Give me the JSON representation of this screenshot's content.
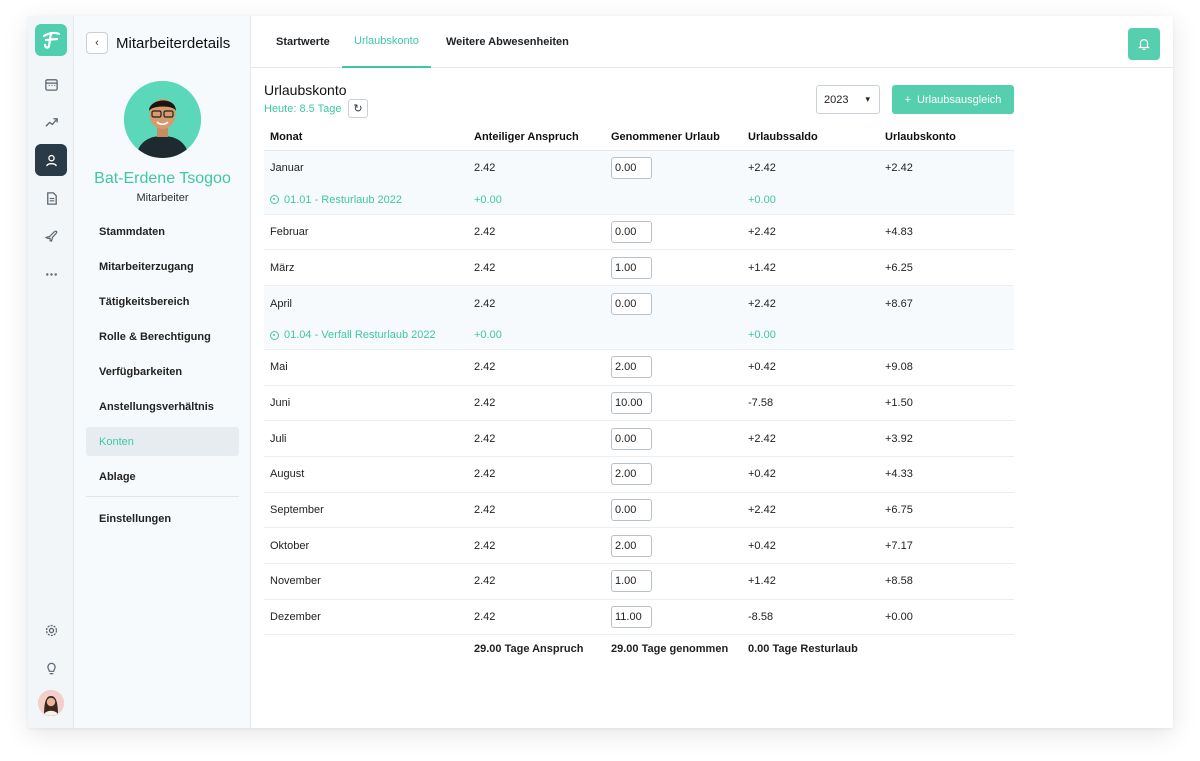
{
  "panel": {
    "title": "Mitarbeiterdetails",
    "name": "Bat-Erdene Tsogoo",
    "role": "Mitarbeiter",
    "nav": [
      {
        "label": "Stammdaten",
        "active": false
      },
      {
        "label": "Mitarbeiterzugang",
        "active": false
      },
      {
        "label": "Tätigkeitsbereich",
        "active": false
      },
      {
        "label": "Rolle & Berechtigung",
        "active": false
      },
      {
        "label": "Verfügbarkeiten",
        "active": false
      },
      {
        "label": "Anstellungsverhältnis",
        "active": false
      },
      {
        "label": "Konten",
        "active": true
      },
      {
        "label": "Ablage",
        "active": false
      },
      {
        "label": "Einstellungen",
        "active": false
      }
    ]
  },
  "rail": {
    "icons": [
      "calendar-icon",
      "trend-icon",
      "user-icon",
      "document-icon",
      "plane-icon",
      "more-icon",
      "settings-icon",
      "lightbulb-icon"
    ]
  },
  "tabs": [
    {
      "label": "Startwerte",
      "active": false
    },
    {
      "label": "Urlaubskonto",
      "active": true
    },
    {
      "label": "Weitere Abwesenheiten",
      "active": false
    }
  ],
  "account": {
    "title": "Urlaubskonto",
    "today": "Heute: 8.5 Tage",
    "year": "2023",
    "balance_button": "Urlaubsausgleich"
  },
  "table": {
    "headers": [
      "Monat",
      "Anteiliger Anspruch",
      "Genommener Urlaub",
      "Urlaubssaldo",
      "Urlaubskonto"
    ],
    "rows": [
      {
        "month": "Januar",
        "entitlement": "2.42",
        "taken": "0.00",
        "saldo": "+2.42",
        "konto": "+2.42",
        "sub": {
          "label": "01.01 - Resturlaub 2022",
          "entitlement": "+0.00",
          "saldo": "+0.00"
        }
      },
      {
        "month": "Februar",
        "entitlement": "2.42",
        "taken": "0.00",
        "saldo": "+2.42",
        "konto": "+4.83"
      },
      {
        "month": "März",
        "entitlement": "2.42",
        "taken": "1.00",
        "saldo": "+1.42",
        "konto": "+6.25"
      },
      {
        "month": "April",
        "entitlement": "2.42",
        "taken": "0.00",
        "saldo": "+2.42",
        "konto": "+8.67",
        "sub": {
          "label": "01.04 - Verfall Resturlaub 2022",
          "entitlement": "+0.00",
          "saldo": "+0.00"
        }
      },
      {
        "month": "Mai",
        "entitlement": "2.42",
        "taken": "2.00",
        "saldo": "+0.42",
        "konto": "+9.08"
      },
      {
        "month": "Juni",
        "entitlement": "2.42",
        "taken": "10.00",
        "saldo": "-7.58",
        "konto": "+1.50"
      },
      {
        "month": "Juli",
        "entitlement": "2.42",
        "taken": "0.00",
        "saldo": "+2.42",
        "konto": "+3.92"
      },
      {
        "month": "August",
        "entitlement": "2.42",
        "taken": "2.00",
        "saldo": "+0.42",
        "konto": "+4.33"
      },
      {
        "month": "September",
        "entitlement": "2.42",
        "taken": "0.00",
        "saldo": "+2.42",
        "konto": "+6.75"
      },
      {
        "month": "Oktober",
        "entitlement": "2.42",
        "taken": "2.00",
        "saldo": "+0.42",
        "konto": "+7.17"
      },
      {
        "month": "November",
        "entitlement": "2.42",
        "taken": "1.00",
        "saldo": "+1.42",
        "konto": "+8.58"
      },
      {
        "month": "Dezember",
        "entitlement": "2.42",
        "taken": "11.00",
        "saldo": "-8.58",
        "konto": "+0.00"
      }
    ],
    "totals": {
      "entitlement": "29.00 Tage Anspruch",
      "taken": "29.00 Tage genommen",
      "saldo": "0.00 Tage Resturlaub"
    }
  },
  "colors": {
    "accent": "#3fc7a4",
    "rail_active": "#2a3a46"
  }
}
